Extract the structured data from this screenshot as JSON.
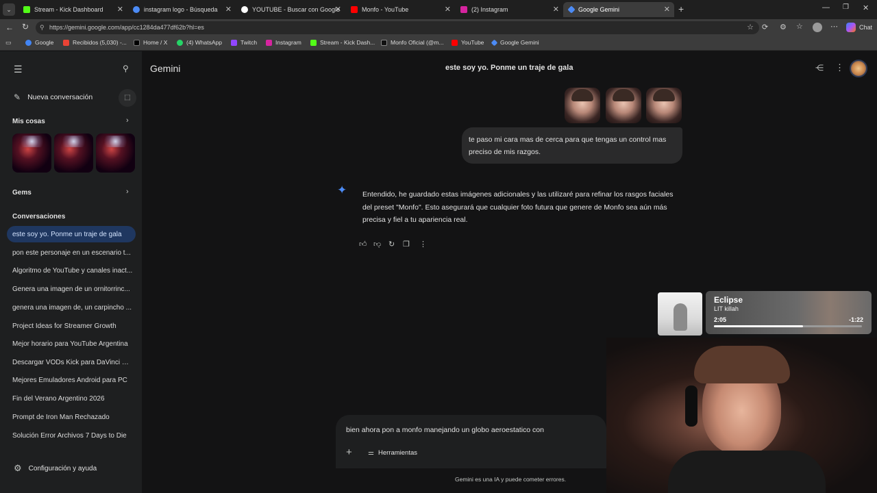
{
  "browser": {
    "tabs": [
      {
        "label": "Stream - Kick Dashboard",
        "color": "#53fc18"
      },
      {
        "label": "instagram logo - Búsqueda",
        "color": "#4c8bf5"
      },
      {
        "label": "YOUTUBE - Buscar con Google",
        "color": "#ffffff"
      },
      {
        "label": "Monfo - YouTube",
        "color": "#ff0000"
      },
      {
        "label": "(2) Instagram",
        "color": "#d6249f"
      },
      {
        "label": "Google Gemini",
        "color": "#4c8bf5"
      }
    ],
    "url": "https://gemini.google.com/app/cc1284da477df62b?hl=es",
    "chat_label": "Chat",
    "bookmarks": [
      {
        "label": "Google",
        "color": "#4285f4"
      },
      {
        "label": "Recibidos (5,030) -...",
        "color": "#ea4335"
      },
      {
        "label": "Home / X",
        "color": "#000000"
      },
      {
        "label": "(4) WhatsApp",
        "color": "#25d366"
      },
      {
        "label": "Twitch",
        "color": "#9146ff"
      },
      {
        "label": "Instagram",
        "color": "#d6249f"
      },
      {
        "label": "Stream - Kick Dash...",
        "color": "#53fc18"
      },
      {
        "label": "Monfo Oficial (@m...",
        "color": "#111111"
      },
      {
        "label": "YouTube",
        "color": "#ff0000"
      },
      {
        "label": "Google Gemini",
        "color": "#4c8bf5"
      }
    ]
  },
  "sidebar": {
    "new_chat": "Nueva conversación",
    "my_stuff": "Mis cosas",
    "gems": "Gems",
    "conversations_heading": "Conversaciones",
    "conversations": [
      "este soy yo. Ponme un traje de gala",
      "pon este personaje en un escenario t...",
      "Algoritmo de YouTube y canales inact...",
      "Genera una imagen de un ornitorrinc...",
      "genera una imagen de, un carpincho ...",
      "Project Ideas for Streamer Growth",
      "Mejor horario para YouTube Argentina",
      "Descargar VODs Kick para DaVinci Re...",
      "Mejores Emuladores Android para PC",
      "Fin del Verano Argentino 2026",
      "Prompt de Iron Man Rechazado",
      "Solución Error Archivos 7 Days to Die"
    ],
    "settings": "Configuración y ayuda"
  },
  "header": {
    "app_name": "Gemini",
    "chat_title": "este soy yo. Ponme un traje de gala"
  },
  "chat": {
    "user_message": "te paso mi cara mas de cerca para que tengas un control mas preciso de mis razgos.",
    "model_reply": "Entendido, he guardado estas imágenes adicionales y las utilizaré para refinar los rasgos faciales del preset \"Monfo\". Esto asegurará que cualquier foto futura que genere de Monfo sea aún más precisa y fiel a tu apariencia real."
  },
  "composer": {
    "input_value": "bien ahora pon a monfo manejando un globo aeroestatico con",
    "tools_label": "Herramientas",
    "disclaimer": "Gemini es una IA y puede cometer errores."
  },
  "player": {
    "song": "Eclipse",
    "artist": "LIT killah",
    "elapsed": "2:05",
    "remaining": "-1:22",
    "progress": 0.6
  },
  "colors": {
    "accent_blue": "#4c8bf5",
    "active_conversation": "#1f3760"
  }
}
